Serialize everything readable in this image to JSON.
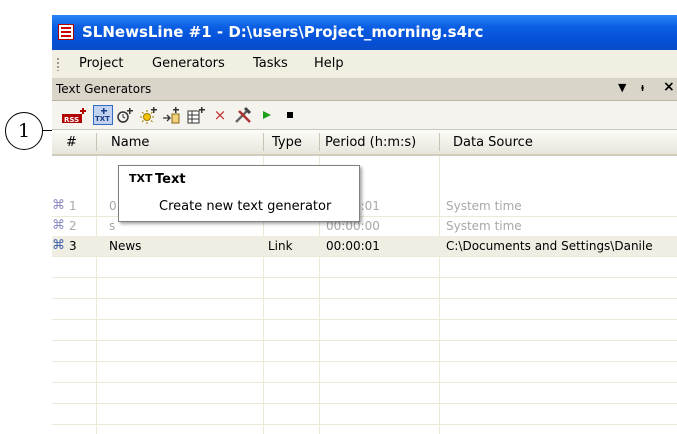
{
  "window": {
    "title": "SLNewsLine #1 - D:\\users\\Project_morning.s4rc"
  },
  "menu": {
    "items": [
      "Project",
      "Generators",
      "Tasks",
      "Help"
    ]
  },
  "panel": {
    "title": "Text Generators",
    "dropdown_glyph": "▼",
    "pin_glyph": "ᵼ",
    "close_glyph": "×"
  },
  "toolbar": {
    "buttons": [
      {
        "name": "rss-generator-button",
        "icon": "rss-icon"
      },
      {
        "name": "text-generator-button",
        "icon": "text-icon",
        "active": true
      },
      {
        "name": "clock-generator-button",
        "icon": "clock-icon"
      },
      {
        "name": "sun-generator-button",
        "icon": "sun-icon"
      },
      {
        "name": "import-generator-button",
        "icon": "import-icon"
      },
      {
        "name": "table-generator-button",
        "icon": "table-icon"
      },
      {
        "name": "delete-button",
        "icon": "delete-icon"
      },
      {
        "name": "tools-button",
        "icon": "tools-icon"
      },
      {
        "name": "start-button",
        "icon": "play-icon"
      },
      {
        "name": "stop-button",
        "icon": "stop-icon"
      }
    ]
  },
  "grid": {
    "headers": {
      "num": "#",
      "name": "Name",
      "type": "Type",
      "period": "Period (h:m:s)",
      "source": "Data Source"
    },
    "rows": [
      {
        "num": "1",
        "name": "0",
        "type": "",
        "period": "00:00:01",
        "source": "System time",
        "dim": true
      },
      {
        "num": "2",
        "name": "s",
        "type": "",
        "period": "00:00:00",
        "source": "System time",
        "dim": true
      },
      {
        "num": "3",
        "name": "News",
        "type": "Link",
        "period": "00:00:01",
        "source": "C:\\Documents and Settings\\Danile",
        "dim": false
      }
    ]
  },
  "tooltip": {
    "icon_text": "TXT",
    "title": "Text",
    "description": "Create new text generator"
  },
  "callout": {
    "label": "1"
  },
  "colors": {
    "titlebar": "#0b5ee2",
    "selection": "#c1d2ee",
    "dim_text": "#a8a8a8"
  }
}
